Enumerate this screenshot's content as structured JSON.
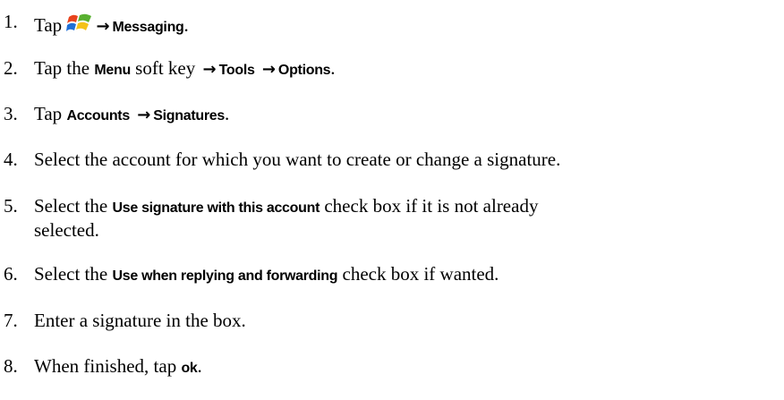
{
  "steps": [
    {
      "num": "1.",
      "tap": "Tap",
      "target": "Messaging",
      "end": "."
    },
    {
      "num": "2.",
      "pre": "Tap the",
      "key": "Menu",
      "mid": "soft key",
      "t1": "Tools",
      "t2": "Options",
      "end": "."
    },
    {
      "num": "3.",
      "pre": "Tap",
      "t1": "Accounts",
      "t2": "Signatures",
      "end": "."
    },
    {
      "num": "4.",
      "text": "Select the account for which you want to create or change a signature."
    },
    {
      "num": "5.",
      "pre": "Select the",
      "ui": "Use signature with this account",
      "post": "check box if it is not already",
      "line2": "selected."
    },
    {
      "num": "6.",
      "pre": "Select the",
      "ui": "Use when replying and forwarding",
      "post": "check box if wanted."
    },
    {
      "num": "7.",
      "text": "Enter a signature in the box."
    },
    {
      "num": "8.",
      "pre": "When finished, tap",
      "ui": "ok",
      "end": "."
    }
  ],
  "icons": {
    "start": "windows-start-icon",
    "arrow": "right-arrow-icon",
    "arrow_glyph": "→"
  }
}
